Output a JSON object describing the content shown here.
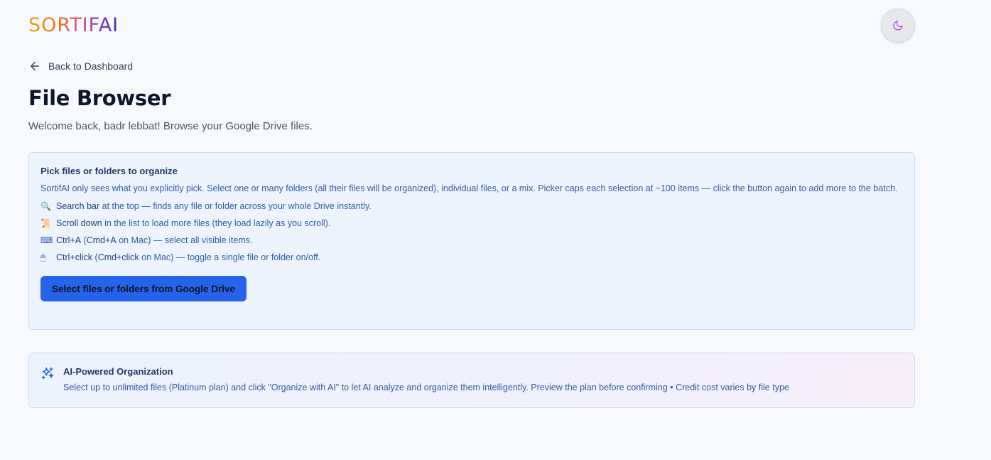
{
  "header": {
    "logo_text": "SORTIFAI",
    "theme_toggle_icon": "moon-icon"
  },
  "nav": {
    "back_label": "Back to Dashboard"
  },
  "page": {
    "title": "File Browser",
    "subtitle": "Welcome back, badr lebbat! Browse your Google Drive files."
  },
  "picker": {
    "title": "Pick files or folders to organize",
    "description": "SortifAI only sees what you explicitly pick. Select one or many folders (all their files will be organized), individual files, or a mix. Picker caps each selection at ~100 items — click the button again to add more to the batch.",
    "tips": [
      {
        "icon": "🔍",
        "bold": "Search bar",
        "rest": " at the top — finds any file or folder across your whole Drive instantly."
      },
      {
        "icon": "📜",
        "bold": "Scroll down",
        "rest": " in the list to load more files (they load lazily as you scroll)."
      },
      {
        "icon": "⌨",
        "bold": "Ctrl+A",
        "mid": " (",
        "bold2": "Cmd+A",
        "rest": " on Mac) — select all visible items."
      },
      {
        "icon": "🖱",
        "bold": "Ctrl+click",
        "mid": " (",
        "bold2": "Cmd+click",
        "rest": " on Mac) — toggle a single file or folder on/off."
      }
    ],
    "button_label": "Select files or folders from Google Drive"
  },
  "ai_card": {
    "title": "AI-Powered Organization",
    "description": "Select up to unlimited files (Platinum plan) and click \"Organize with AI\" to let AI analyze and organize them intelligently. Preview the plan before confirming • Credit cost varies by file type",
    "icon": "sparkles-icon"
  },
  "colors": {
    "accent": "#2563eb",
    "background": "#f7f9fc",
    "card_bg": "#eef4fd",
    "card_border": "#c9dbf3",
    "toggle_icon": "#a855f7"
  }
}
